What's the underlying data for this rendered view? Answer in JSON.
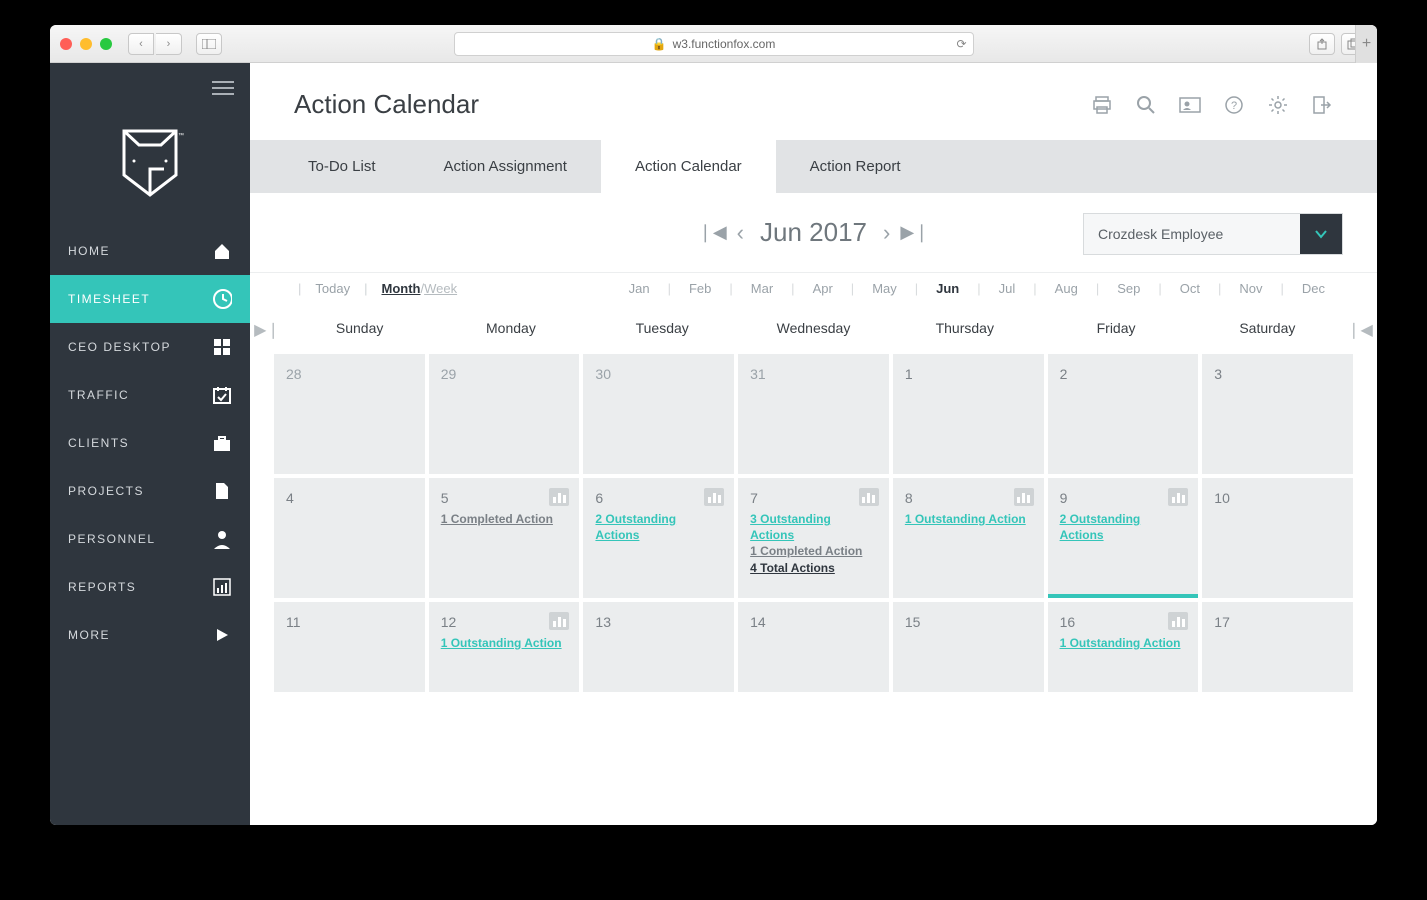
{
  "browser": {
    "url": "w3.functionfox.com"
  },
  "sidebar": {
    "items": [
      {
        "label": "HOME",
        "icon": "home"
      },
      {
        "label": "TIMESHEET",
        "icon": "clock",
        "active": true
      },
      {
        "label": "CEO DESKTOP",
        "icon": "dashboard"
      },
      {
        "label": "TRAFFIC",
        "icon": "calendar-check"
      },
      {
        "label": "CLIENTS",
        "icon": "briefcase"
      },
      {
        "label": "PROJECTS",
        "icon": "file"
      },
      {
        "label": "PERSONNEL",
        "icon": "person"
      },
      {
        "label": "REPORTS",
        "icon": "bar-chart"
      },
      {
        "label": "MORE",
        "icon": "play"
      }
    ]
  },
  "header": {
    "title": "Action Calendar"
  },
  "tabs": [
    {
      "label": "To-Do List"
    },
    {
      "label": "Action Assignment"
    },
    {
      "label": "Action Calendar",
      "active": true
    },
    {
      "label": "Action Report"
    }
  ],
  "monthNav": {
    "label": "Jun 2017",
    "employee": "Crozdesk Employee"
  },
  "viewBar": {
    "today": "Today",
    "month": "Month",
    "week": "Week",
    "months": [
      "Jan",
      "Feb",
      "Mar",
      "Apr",
      "May",
      "Jun",
      "Jul",
      "Aug",
      "Sep",
      "Oct",
      "Nov",
      "Dec"
    ],
    "current": "Jun"
  },
  "days": [
    "Sunday",
    "Monday",
    "Tuesday",
    "Wednesday",
    "Thursday",
    "Friday",
    "Saturday"
  ],
  "weeks": [
    [
      {
        "n": "28",
        "out": true
      },
      {
        "n": "29",
        "out": true
      },
      {
        "n": "30",
        "out": true
      },
      {
        "n": "31",
        "out": true
      },
      {
        "n": "1"
      },
      {
        "n": "2"
      },
      {
        "n": "3"
      }
    ],
    [
      {
        "n": "4"
      },
      {
        "n": "5",
        "bars": true,
        "lines": [
          {
            "t": "1 Completed Action",
            "c": "comp"
          }
        ]
      },
      {
        "n": "6",
        "bars": true,
        "lines": [
          {
            "t": "2 Outstanding Actions",
            "c": "out"
          }
        ]
      },
      {
        "n": "7",
        "bars": true,
        "lines": [
          {
            "t": "3 Outstanding Actions",
            "c": "out"
          },
          {
            "t": "1 Completed Action",
            "c": "comp"
          },
          {
            "t": "4 Total Actions",
            "c": "tot"
          }
        ]
      },
      {
        "n": "8",
        "bars": true,
        "lines": [
          {
            "t": "1 Outstanding Action",
            "c": "out"
          }
        ]
      },
      {
        "n": "9",
        "bars": true,
        "highlight": true,
        "lines": [
          {
            "t": "2 Outstanding Actions",
            "c": "out"
          }
        ]
      },
      {
        "n": "10"
      }
    ],
    [
      {
        "n": "11"
      },
      {
        "n": "12",
        "bars": true,
        "lines": [
          {
            "t": "1 Outstanding Action",
            "c": "out"
          }
        ]
      },
      {
        "n": "13"
      },
      {
        "n": "14"
      },
      {
        "n": "15"
      },
      {
        "n": "16",
        "bars": true,
        "lines": [
          {
            "t": "1 Outstanding Action",
            "c": "out"
          }
        ]
      },
      {
        "n": "17"
      }
    ]
  ]
}
